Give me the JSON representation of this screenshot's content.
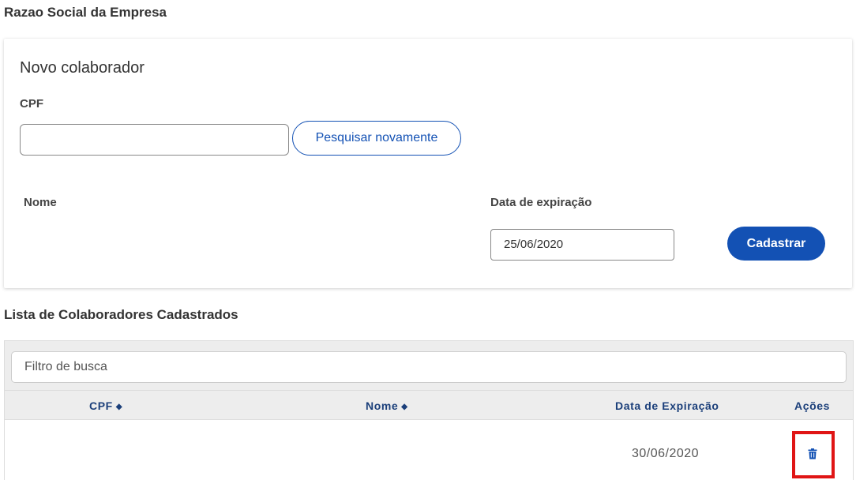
{
  "company": {
    "title": "Razao Social da Empresa"
  },
  "new_collaborator": {
    "title": "Novo colaborador",
    "cpf_label": "CPF",
    "cpf_value": "",
    "search_again_label": "Pesquisar novamente",
    "nome_label": "Nome",
    "expiration_label": "Data de expiração",
    "expiration_value": "25/06/2020",
    "register_label": "Cadastrar"
  },
  "list": {
    "title": "Lista de Colaboradores Cadastrados",
    "filter_placeholder": "Filtro de busca",
    "columns": {
      "cpf": "CPF",
      "nome": "Nome",
      "expiration": "Data de Expiração",
      "actions": "Ações"
    },
    "rows": [
      {
        "cpf": "",
        "nome": "",
        "expiration": "30/06/2020",
        "action_icon": "trash-icon"
      }
    ]
  },
  "colors": {
    "primary": "#1351b4",
    "header_text": "#1b3f7a",
    "highlight": "#e01515"
  }
}
